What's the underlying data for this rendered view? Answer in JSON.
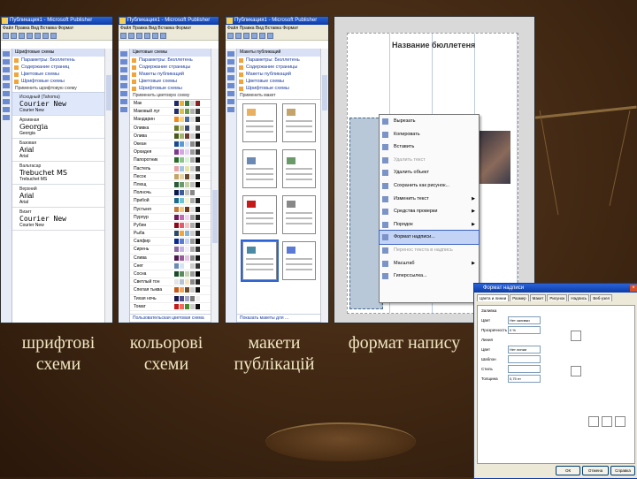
{
  "captions": {
    "fonts": "шрифтові\nсхеми",
    "colors": "кольорові\nсхеми",
    "layouts": "макети\nпублікацій",
    "format": "формат напису"
  },
  "shot1": {
    "title": "Публикация1 - Microsoft Publisher",
    "menu": "Файл  Правка  Вид  Вставка  Формат",
    "pane_title": "Шрифтовые схемы",
    "links": [
      "Параметры: Бюллетень",
      "Содержание страниц",
      "Цветовые схемы",
      "Шрифтовые схемы"
    ],
    "apply_label": "Применить шрифтовую схему",
    "fonts": [
      {
        "name": "Исходный (Tahoma)",
        "a": "Courier New",
        "b": "Courier New"
      },
      {
        "name": "Архивная",
        "a": "Georgia",
        "b": "Georgia"
      },
      {
        "name": "Базовая",
        "a": "Arial",
        "b": "Arial"
      },
      {
        "name": "Вальтасар",
        "a": "Trebuchet MS",
        "b": "Trebuchet MS"
      },
      {
        "name": "Верхний",
        "a": "Arial",
        "b": "Arial"
      },
      {
        "name": "Визит",
        "a": "Courier New",
        "b": "Courier New"
      }
    ]
  },
  "shot2": {
    "title": "Публикация1 - Microsoft Publisher",
    "menu": "Файл  Правка  Вид  Вставка  Формат",
    "pane_title": "Цветовые схемы",
    "links": [
      "Параметры: Бюллетень",
      "Содержание страницы",
      "Макеты публикаций",
      "Цветовые схемы",
      "Шрифтовые схемы"
    ],
    "apply_label": "Применить цветовую схему",
    "footer": "Пользовательская цветовая схема",
    "schemes": [
      {
        "name": "Мак",
        "colors": [
          "#1d2a6a",
          "#e8b23a",
          "#3a7a3a",
          "#d4d4d4",
          "#8a2020"
        ]
      },
      {
        "name": "Маковый луг",
        "colors": [
          "#24306e",
          "#d8c24a",
          "#6a9a4a",
          "#b0b0b0",
          "#3a3a3a"
        ]
      },
      {
        "name": "Мандарин",
        "colors": [
          "#f08a20",
          "#ffd27a",
          "#4a6a9a",
          "#ddd",
          "#222"
        ]
      },
      {
        "name": "Оливка",
        "colors": [
          "#6a7a2a",
          "#c4c48a",
          "#3a4a6a",
          "#eee",
          "#555"
        ]
      },
      {
        "name": "Олива",
        "colors": [
          "#4a5a1a",
          "#a4b46a",
          "#6a3a2a",
          "#ccc",
          "#111"
        ]
      },
      {
        "name": "Океан",
        "colors": [
          "#1a4a8a",
          "#5a9ad4",
          "#d4e4f4",
          "#888",
          "#222"
        ]
      },
      {
        "name": "Орхидея",
        "colors": [
          "#7a3a8a",
          "#d4a4e4",
          "#e4d4f4",
          "#999",
          "#333"
        ]
      },
      {
        "name": "Папоротник",
        "colors": [
          "#2a6a2a",
          "#8ac48a",
          "#d4f4d4",
          "#aaa",
          "#111"
        ]
      },
      {
        "name": "Пастель",
        "colors": [
          "#e4a4a4",
          "#a4c4e4",
          "#e4e4a4",
          "#ccc",
          "#444"
        ]
      },
      {
        "name": "Песок",
        "colors": [
          "#c4a46a",
          "#e4d4a4",
          "#6a4a2a",
          "#ddd",
          "#222"
        ]
      },
      {
        "name": "Плющ",
        "colors": [
          "#2a5a3a",
          "#6a9a6a",
          "#c4d4a4",
          "#bbb",
          "#000"
        ]
      },
      {
        "name": "Полночь",
        "colors": [
          "#0a1a4a",
          "#3a5a9a",
          "#c4c4c4",
          "#888",
          "#fff"
        ]
      },
      {
        "name": "Прибой",
        "colors": [
          "#1a6a8a",
          "#6ac4d4",
          "#f4f4d4",
          "#aaa",
          "#222"
        ]
      },
      {
        "name": "Пустыня",
        "colors": [
          "#c47a3a",
          "#f4c47a",
          "#6a3a1a",
          "#ddd",
          "#111"
        ]
      },
      {
        "name": "Пурпур",
        "colors": [
          "#6a1a5a",
          "#c46ab4",
          "#f4d4f4",
          "#999",
          "#222"
        ]
      },
      {
        "name": "Рубин",
        "colors": [
          "#8a0a1a",
          "#e45a6a",
          "#f4c4c4",
          "#aaa",
          "#111"
        ]
      },
      {
        "name": "Рыба",
        "colors": [
          "#2a4a6a",
          "#f4a43a",
          "#8ab4d4",
          "#ccc",
          "#222"
        ]
      },
      {
        "name": "Сапфир",
        "colors": [
          "#0a2a8a",
          "#5a7ad4",
          "#c4d4f4",
          "#999",
          "#000"
        ]
      },
      {
        "name": "Сирень",
        "colors": [
          "#8a6aa4",
          "#c4b4e4",
          "#f4eef8",
          "#aaa",
          "#333"
        ]
      },
      {
        "name": "Слива",
        "colors": [
          "#4a1a4a",
          "#9a5a9a",
          "#e4c4e4",
          "#888",
          "#111"
        ]
      },
      {
        "name": "Снег",
        "colors": [
          "#6a8ab4",
          "#d4e4f4",
          "#ffffff",
          "#ccc",
          "#333"
        ]
      },
      {
        "name": "Сосна",
        "colors": [
          "#1a4a2a",
          "#5a8a5a",
          "#c4d4b4",
          "#999",
          "#000"
        ]
      },
      {
        "name": "Светлый тон",
        "colors": [
          "#e4e4e4",
          "#b4c4d4",
          "#f4e4c4",
          "#888",
          "#222"
        ]
      },
      {
        "name": "Спелая тыква",
        "colors": [
          "#c45a1a",
          "#f4a45a",
          "#6a4a2a",
          "#ccc",
          "#111"
        ]
      },
      {
        "name": "Тихая ночь",
        "colors": [
          "#1a1a4a",
          "#4a4a8a",
          "#a4a4c4",
          "#777",
          "#eee"
        ]
      },
      {
        "name": "Томат",
        "colors": [
          "#c41a1a",
          "#f46a5a",
          "#4a8a2a",
          "#ccc",
          "#111"
        ]
      }
    ]
  },
  "shot3": {
    "title": "Публикация1 - Microsoft Publisher",
    "menu": "Файл  Правка  Вид  Вставка  Формат",
    "pane_title": "Макеты публикаций",
    "links": [
      "Параметры: Бюллетень",
      "Содержание страницы",
      "Макеты публикаций",
      "Цветовые схемы",
      "Шрифтовые схемы"
    ],
    "apply_label": "Применить макет",
    "footer": "Показать макеты для ..."
  },
  "shot4": {
    "heading": "Название бюллетеня",
    "menu_items": [
      {
        "label": "Вырезать",
        "disabled": false,
        "submenu": false,
        "highlight": false
      },
      {
        "label": "Копировать",
        "disabled": false,
        "submenu": false,
        "highlight": false
      },
      {
        "label": "Вставить",
        "disabled": false,
        "submenu": false,
        "highlight": false
      },
      {
        "label": "Удалить текст",
        "disabled": true,
        "submenu": false,
        "highlight": false
      },
      {
        "label": "Удалить объект",
        "disabled": false,
        "submenu": false,
        "highlight": false
      },
      {
        "label": "Сохранить как рисунок...",
        "disabled": false,
        "submenu": false,
        "highlight": false
      },
      {
        "label": "Изменить текст",
        "disabled": false,
        "submenu": true,
        "highlight": false
      },
      {
        "label": "Средства проверки",
        "disabled": false,
        "submenu": true,
        "highlight": false
      },
      {
        "label": "Порядок",
        "disabled": false,
        "submenu": true,
        "highlight": false
      },
      {
        "label": "Формат надписи...",
        "disabled": false,
        "submenu": false,
        "highlight": true
      },
      {
        "label": "Перенос текста в надпись",
        "disabled": true,
        "submenu": false,
        "highlight": false
      },
      {
        "label": "Масштаб",
        "disabled": false,
        "submenu": true,
        "highlight": false
      },
      {
        "label": "Гиперссылка...",
        "disabled": false,
        "submenu": false,
        "highlight": false
      }
    ]
  },
  "dialog": {
    "title": "Формат надписи",
    "tabs": [
      "Цвета и линии",
      "Размер",
      "Макет",
      "Рисунок",
      "Надпись",
      "Веб-узел"
    ],
    "fields": [
      {
        "label": "Заливка",
        "value": ""
      },
      {
        "label": "Цвет",
        "value": "Нет заливки"
      },
      {
        "label": "Прозрачность",
        "value": "0 %"
      },
      {
        "label": "Линия",
        "value": ""
      },
      {
        "label": "Цвет",
        "value": "Нет линии"
      },
      {
        "label": "Шаблон",
        "value": ""
      },
      {
        "label": "Стиль",
        "value": ""
      },
      {
        "label": "Толщина",
        "value": "0,75 пт"
      }
    ],
    "ok": "ОК",
    "cancel": "Отмена",
    "help": "Справка"
  }
}
